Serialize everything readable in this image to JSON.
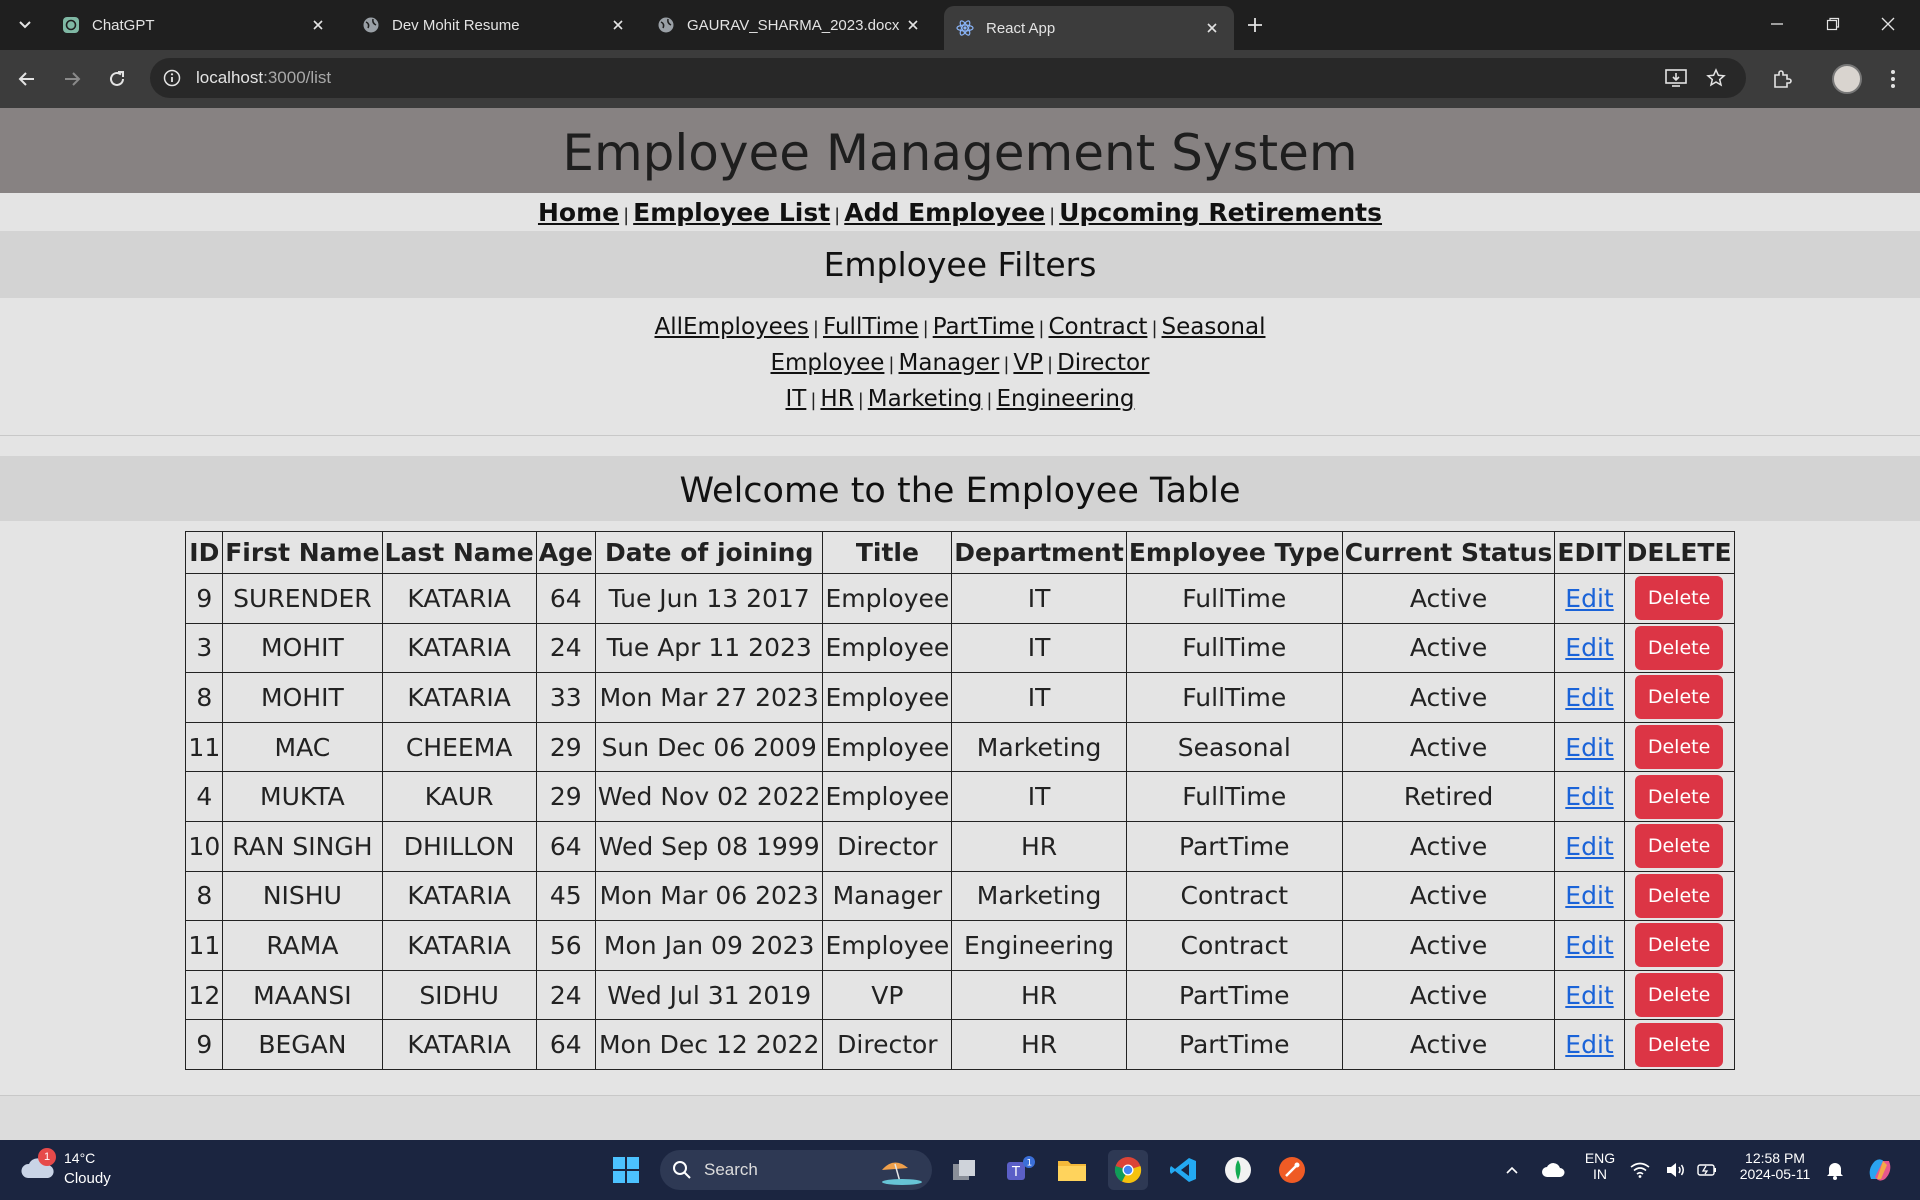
{
  "browser": {
    "tabs": [
      {
        "title": "ChatGPT",
        "icon": "chatgpt-icon",
        "active": false
      },
      {
        "title": "Dev Mohit Resume",
        "icon": "globe-icon",
        "active": false
      },
      {
        "title": "GAURAV_SHARMA_2023.docx",
        "icon": "globe-icon",
        "active": false
      },
      {
        "title": "React App",
        "icon": "react-icon",
        "active": true
      }
    ],
    "url_host": "localhost",
    "url_path": ":3000/list"
  },
  "app": {
    "title": "Employee Management System",
    "nav": [
      "Home",
      "Employee List",
      "Add Employee",
      "Upcoming Retirements"
    ],
    "filters_title": "Employee Filters",
    "filters": {
      "types": [
        "AllEmployees",
        "FullTime",
        "PartTime",
        "Contract",
        "Seasonal"
      ],
      "titles": [
        "Employee",
        "Manager",
        "VP",
        "Director"
      ],
      "departments": [
        "IT",
        "HR",
        "Marketing",
        "Engineering"
      ]
    },
    "table_title": "Welcome to the Employee Table",
    "columns": [
      "ID",
      "First Name",
      "Last Name",
      "Age",
      "Date of joining",
      "Title",
      "Department",
      "Employee Type",
      "Current Status",
      "EDIT",
      "DELETE"
    ],
    "edit_label": "Edit",
    "delete_label": "Delete",
    "rows": [
      [
        "9",
        "SURENDER",
        "KATARIA",
        "64",
        "Tue Jun 13 2017",
        "Employee",
        "IT",
        "FullTime",
        "Active"
      ],
      [
        "3",
        "MOHIT",
        "KATARIA",
        "24",
        "Tue Apr 11 2023",
        "Employee",
        "IT",
        "FullTime",
        "Active"
      ],
      [
        "8",
        "MOHIT",
        "KATARIA",
        "33",
        "Mon Mar 27 2023",
        "Employee",
        "IT",
        "FullTime",
        "Active"
      ],
      [
        "11",
        "MAC",
        "CHEEMA",
        "29",
        "Sun Dec 06 2009",
        "Employee",
        "Marketing",
        "Seasonal",
        "Active"
      ],
      [
        "4",
        "MUKTA",
        "KAUR",
        "29",
        "Wed Nov 02 2022",
        "Employee",
        "IT",
        "FullTime",
        "Retired"
      ],
      [
        "10",
        "RAN SINGH",
        "DHILLON",
        "64",
        "Wed Sep 08 1999",
        "Director",
        "HR",
        "PartTime",
        "Active"
      ],
      [
        "8",
        "NISHU",
        "KATARIA",
        "45",
        "Mon Mar 06 2023",
        "Manager",
        "Marketing",
        "Contract",
        "Active"
      ],
      [
        "11",
        "RAMA",
        "KATARIA",
        "56",
        "Mon Jan 09 2023",
        "Employee",
        "Engineering",
        "Contract",
        "Active"
      ],
      [
        "12",
        "MAANSI",
        "SIDHU",
        "24",
        "Wed Jul 31 2019",
        "VP",
        "HR",
        "PartTime",
        "Active"
      ],
      [
        "9",
        "BEGAN",
        "KATARIA",
        "64",
        "Mon Dec 12 2022",
        "Director",
        "HR",
        "PartTime",
        "Active"
      ]
    ]
  },
  "taskbar": {
    "weather_badge": "1",
    "temperature": "14°C",
    "condition": "Cloudy",
    "search_label": "Search",
    "teams_badge": "1",
    "lang_top": "ENG",
    "lang_bottom": "IN",
    "time": "12:58 PM",
    "date": "2024-05-11"
  },
  "colors": {
    "header_bg": "#878282",
    "delete_button": "#dc3545",
    "link": "#1a63d8"
  }
}
